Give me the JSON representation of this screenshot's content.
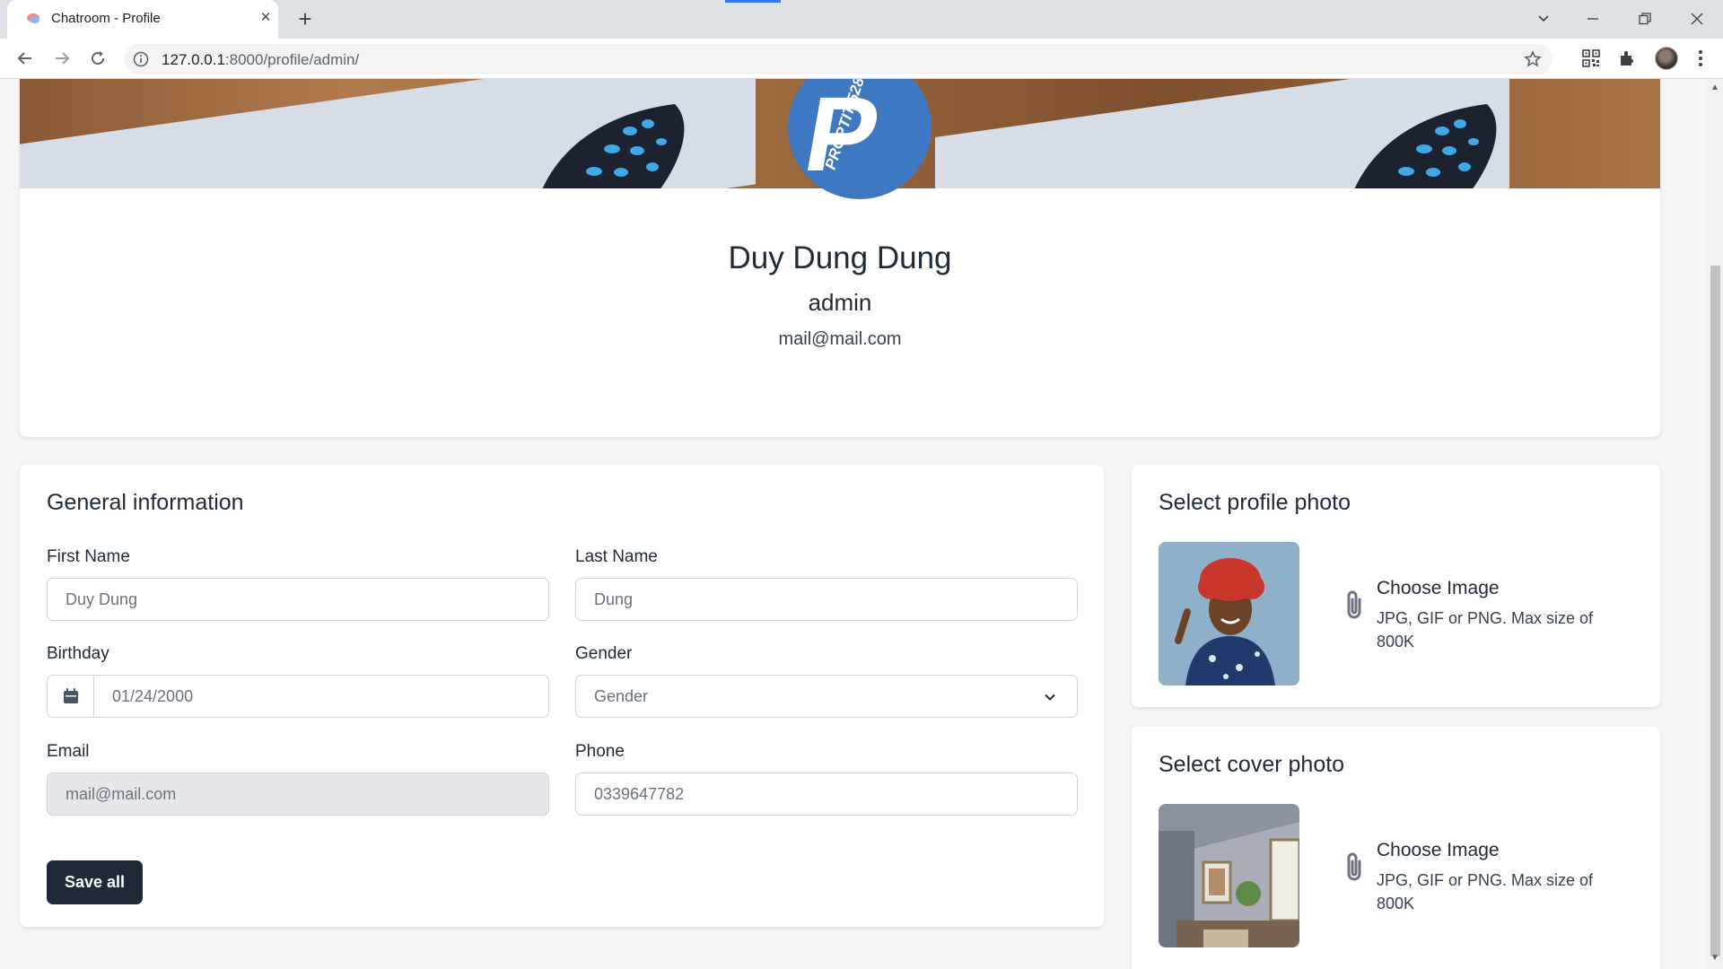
{
  "browser": {
    "tab_title": "Chatroom - Profile",
    "close_glyph": "×",
    "new_tab_glyph": "+",
    "url_host": "127.0.0.1",
    "url_rest": ":8000/profile/admin/"
  },
  "profile": {
    "full_name": "Duy Dung Dung",
    "username": "admin",
    "email": "mail@mail.com",
    "logo_letter": "P",
    "logo_text": "PROPTIT 528"
  },
  "general": {
    "title": "General information",
    "first_name_label": "First Name",
    "first_name_value": "Duy Dung",
    "last_name_label": "Last Name",
    "last_name_value": "Dung",
    "birthday_label": "Birthday",
    "birthday_value": "01/24/2000",
    "gender_label": "Gender",
    "gender_value": "Gender",
    "email_label": "Email",
    "email_value": "mail@mail.com",
    "phone_label": "Phone",
    "phone_value": "0339647782",
    "save_label": "Save all"
  },
  "profile_photo": {
    "title": "Select profile photo",
    "choose_label": "Choose Image",
    "hint": "JPG, GIF or PNG. Max size of 800K"
  },
  "cover_photo": {
    "title": "Select cover photo",
    "choose_label": "Choose Image",
    "hint": "JPG, GIF or PNG. Max size of 800K"
  },
  "colors": {
    "primary_button": "#1f2937",
    "logo_blue": "#3f78c2",
    "page_background": "#f2f4f6"
  },
  "icons": [
    "favicon-icon",
    "close-icon",
    "plus-icon",
    "back-icon",
    "forward-icon",
    "reload-icon",
    "info-icon",
    "star-icon",
    "qr-code-icon",
    "extensions-icon",
    "menu-icon",
    "calendar-icon",
    "chevron-down-icon",
    "paperclip-icon"
  ]
}
